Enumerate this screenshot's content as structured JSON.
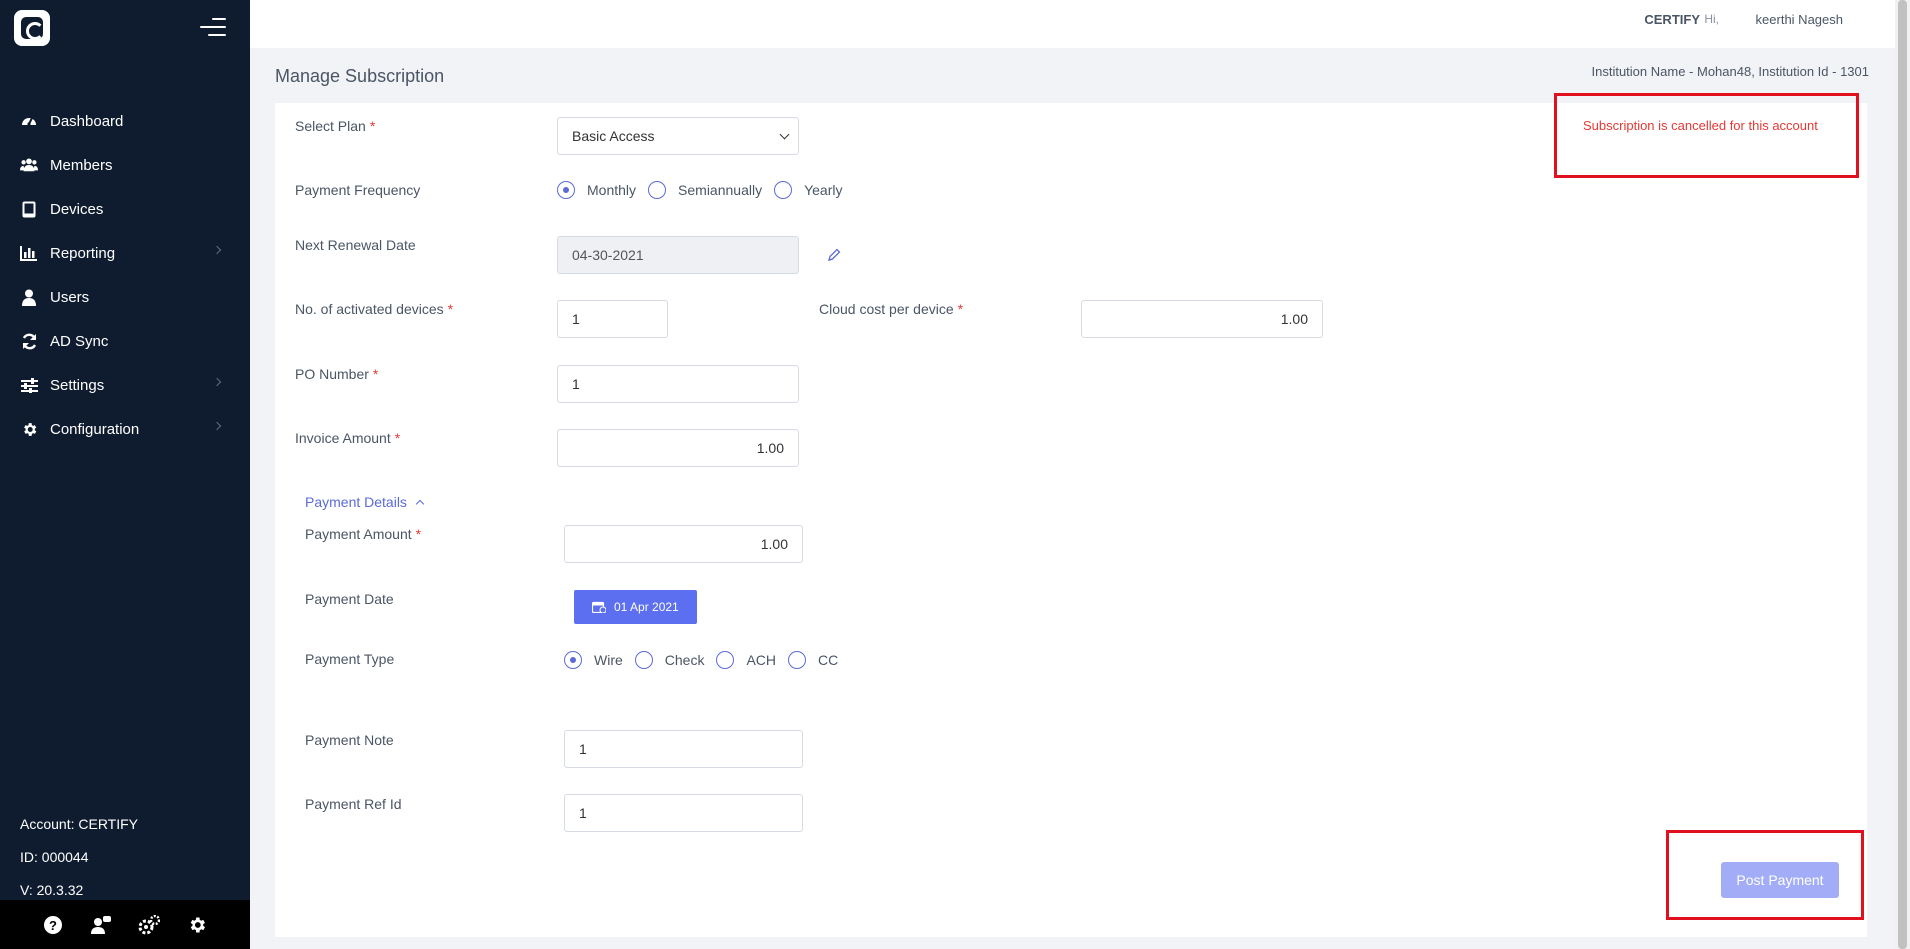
{
  "sidebar": {
    "nav": [
      {
        "label": "Dashboard",
        "icon": "dashboard-icon"
      },
      {
        "label": "Members",
        "icon": "members-icon"
      },
      {
        "label": "Devices",
        "icon": "tablet-icon"
      },
      {
        "label": "Reporting",
        "icon": "bar-chart-icon",
        "has_children": true
      },
      {
        "label": "Users",
        "icon": "user-icon"
      },
      {
        "label": "AD Sync",
        "icon": "sync-icon"
      },
      {
        "label": "Settings",
        "icon": "sliders-icon",
        "has_children": true
      },
      {
        "label": "Configuration",
        "icon": "gear-icon",
        "has_children": true
      }
    ],
    "account": "Account: CERTIFY",
    "id": "ID: 000044",
    "version": "V: 20.3.32",
    "bottom_icons": [
      "help-icon",
      "user-chat-icon",
      "gears-icon",
      "gear-icon"
    ]
  },
  "header": {
    "org": "CERTIFY",
    "greeting": "Hi,",
    "user_name": "keerthi Nagesh"
  },
  "page": {
    "title": "Manage Subscription",
    "institution_info": "Institution Name - Mohan48,   Institution Id - 1301"
  },
  "form": {
    "select_plan": {
      "label": "Select Plan",
      "value": "Basic Access"
    },
    "payment_frequency": {
      "label": "Payment Frequency",
      "options": [
        "Monthly",
        "Semiannually",
        "Yearly"
      ],
      "selected": "Monthly"
    },
    "next_renewal_date": {
      "label": "Next Renewal Date",
      "value": "04-30-2021"
    },
    "activated_devices": {
      "label": "No. of activated devices",
      "value": "1"
    },
    "cloud_cost": {
      "label": "Cloud cost per device",
      "value": "1.00"
    },
    "po_number": {
      "label": "PO Number",
      "value": "1"
    },
    "invoice_amount": {
      "label": "Invoice Amount",
      "value": "1.00"
    },
    "payment_details_toggle": "Payment Details",
    "payment_amount": {
      "label": "Payment Amount",
      "value": "1.00"
    },
    "payment_date": {
      "label": "Payment Date",
      "value": "01 Apr 2021"
    },
    "payment_type": {
      "label": "Payment Type",
      "options": [
        "Wire",
        "Check",
        "ACH",
        "CC"
      ],
      "selected": "Wire"
    },
    "payment_note": {
      "label": "Payment Note",
      "value": "1"
    },
    "payment_ref_id": {
      "label": "Payment Ref Id",
      "value": "1"
    },
    "submit_label": "Post Payment"
  },
  "alert": {
    "message": "Subscription is cancelled for this account",
    "color": "#e53935"
  },
  "colors": {
    "sidebar_bg": "#0f1c30",
    "accent": "#5b6ff0",
    "highlight_box": "#e0101f"
  }
}
